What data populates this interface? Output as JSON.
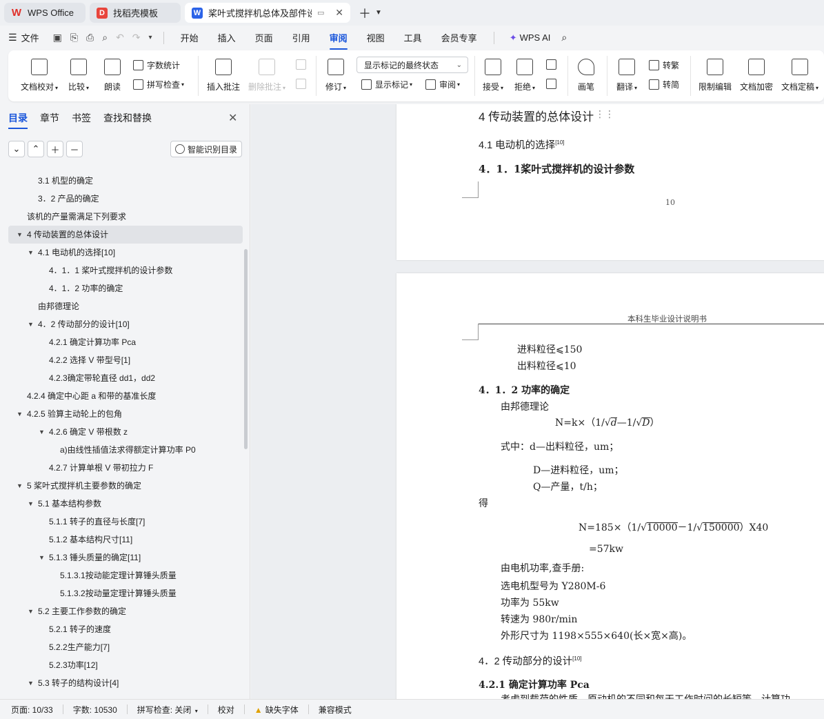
{
  "tabs": [
    {
      "label": "WPS Office",
      "icon": "wps-logo-icon"
    },
    {
      "label": "找稻壳模板",
      "icon": "docer-logo-icon"
    },
    {
      "label": "桨叶式搅拌机总体及部件设计",
      "icon": "writer-doc-icon"
    }
  ],
  "menubar": {
    "file": "文件",
    "items": [
      "开始",
      "插入",
      "页面",
      "引用",
      "审阅",
      "视图",
      "工具",
      "会员专享"
    ],
    "active": "审阅",
    "ai": "WPS AI"
  },
  "ribbon": {
    "doc_proof": "文档校对",
    "compare": "比较",
    "read_aloud": "朗读",
    "word_count": "字数统计",
    "spell_check": "拼写检查",
    "insert_comment": "插入批注",
    "delete_comment": "删除批注",
    "revise": "修订",
    "markup_state": "显示标记的最终状态",
    "show_markup": "显示标记",
    "review": "审阅",
    "accept": "接受",
    "reject": "拒绝",
    "pen": "画笔",
    "translate": "翻译",
    "to_traditional": "转繁",
    "to_simplified": "转简",
    "restrict_edit": "限制编辑",
    "encrypt": "文档加密",
    "finalize": "文档定稿"
  },
  "panel": {
    "tabs": [
      "目录",
      "章节",
      "书签",
      "查找和替换"
    ],
    "smart_toc": "智能识别目录",
    "toc": [
      {
        "text": "3.1 机型的确定",
        "indent": 2,
        "arrow": false
      },
      {
        "text": "3．2 产品的确定",
        "indent": 2,
        "arrow": false
      },
      {
        "text": "该机的产量需满足下列要求",
        "indent": 1,
        "arrow": false
      },
      {
        "text": "4 传动装置的总体设计",
        "indent": 1,
        "arrow": true,
        "selected": true
      },
      {
        "text": "4.1 电动机的选择[10]",
        "indent": 2,
        "arrow": true
      },
      {
        "text": "4．1．1 桨叶式搅拌机的设计参数",
        "indent": 3,
        "arrow": false
      },
      {
        "text": "4．1．2 功率的确定",
        "indent": 3,
        "arrow": false
      },
      {
        "text": "由邦德理论",
        "indent": 2,
        "arrow": false
      },
      {
        "text": "4．2 传动部分的设计[10]",
        "indent": 2,
        "arrow": true
      },
      {
        "text": "4.2.1 确定计算功率 Pca",
        "indent": 3,
        "arrow": false
      },
      {
        "text": "4.2.2 选择 V 带型号[1]",
        "indent": 3,
        "arrow": false
      },
      {
        "text": "4.2.3确定带轮直径 dd1，dd2",
        "indent": 3,
        "arrow": false
      },
      {
        "text": "4.2.4 确定中心距 a 和带的基准长度",
        "indent": 1,
        "arrow": false
      },
      {
        "text": "4.2.5 验算主动轮上的包角",
        "indent": 1,
        "arrow": true
      },
      {
        "text": "4.2.6 确定 V 带根数 z",
        "indent": 3,
        "arrow": true
      },
      {
        "text": "a)由线性插值法求得额定计算功率 P0",
        "indent": 4,
        "arrow": false
      },
      {
        "text": "4.2.7 计算单根 V 带初拉力 F",
        "indent": 3,
        "arrow": false
      },
      {
        "text": "5 桨叶式搅拌机主要参数的确定",
        "indent": 1,
        "arrow": true
      },
      {
        "text": "5.1 基本结构参数",
        "indent": 2,
        "arrow": true
      },
      {
        "text": "5.1.1 转子的直径与长度[7]",
        "indent": 3,
        "arrow": false
      },
      {
        "text": "5.1.2 基本结构尺寸[11]",
        "indent": 3,
        "arrow": false
      },
      {
        "text": "5.1.3 锤头质量的确定[11]",
        "indent": 3,
        "arrow": true
      },
      {
        "text": "5.1.3.1按动能定理计算锤头质量",
        "indent": 4,
        "arrow": false
      },
      {
        "text": "5.1.3.2按动量定理计算锤头质量",
        "indent": 4,
        "arrow": false
      },
      {
        "text": "5.2 主要工作参数的确定",
        "indent": 2,
        "arrow": true
      },
      {
        "text": "5.2.1 转子的速度",
        "indent": 3,
        "arrow": false
      },
      {
        "text": "5.2.2生产能力[7]",
        "indent": 3,
        "arrow": false
      },
      {
        "text": "5.2.3功率[12]",
        "indent": 3,
        "arrow": false
      },
      {
        "text": "5.3 转子的结构设计[4]",
        "indent": 2,
        "arrow": true
      }
    ]
  },
  "doc": {
    "p1_h1": "4 传动装置的总体设计",
    "p1_h2": "4.1 电动机的选择",
    "p1_h2_ref": "[10]",
    "p1_h3": "4．1．1桨叶式搅拌机的设计参数",
    "p1_pageno": "10",
    "header": "本科生毕业设计说明书",
    "l_in": "进料粒径⩽150",
    "l_out": "出料粒径⩽10",
    "h_power": "4．1．2 功率的确定",
    "bond": "由邦德理论",
    "f1_a": "N=k×（1/",
    "f1_d": "d",
    "f1_b": "—1/",
    "f1_D": "D",
    "f1_c": "）",
    "where_d": "式中：d—出料粒径，um；",
    "where_D": "D—进料粒径，um；",
    "where_Q": "Q—产量，t/h；",
    "de": "得",
    "f2_a": "N=185×（1/",
    "f2_s1": "10000",
    "f2_b": "－1/",
    "f2_s2": "150000",
    "f2_c": "）X40",
    "f2_r": "=57kw",
    "motor": "由电机功率,查手册:",
    "model": "选电机型号为 Y280M-6",
    "pw": "功率为 55kw",
    "spd": "转速为 980r/min",
    "dim": "外形尺寸为 1198×555×640(长×宽×高)。",
    "h42": "4．2 传动部分的设计",
    "h42_ref": "[10]",
    "h421": "4.2.1 确定计算功率 Pca",
    "cut": "考虑到载荷的性质，原动机的不同和每天工作时间的长短等，计算功"
  },
  "status": {
    "page": "页面: 10/33",
    "words": "字数: 10530",
    "spell": "拼写检查: 关闭",
    "proof": "校对",
    "missing_font": "缺失字体",
    "compat": "兼容模式"
  },
  "colors": {
    "accent": "#1a56db",
    "wps_red": "#e0302a"
  }
}
